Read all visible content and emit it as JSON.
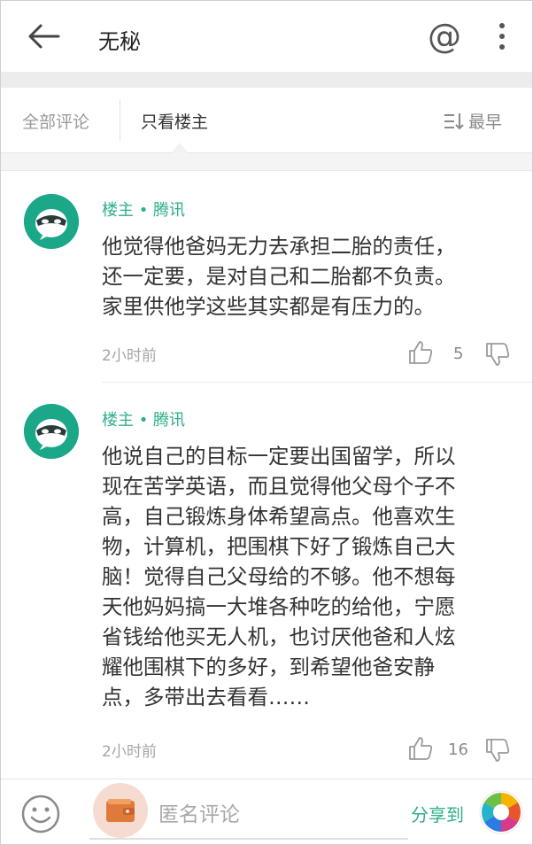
{
  "header": {
    "title": "无秘",
    "at_symbol": "@"
  },
  "filter": {
    "all_label": "全部评论",
    "owner_label": "只看楼主",
    "sort_label": "最早"
  },
  "comments": [
    {
      "author": "楼主 • 腾讯",
      "text": "他觉得他爸妈无力去承担二胎的责任，\n还一定要，是对自己和二胎都不负责。\n家里供他学这些其实都是有压力的。",
      "time": "2小时前",
      "likes": "5"
    },
    {
      "author": "楼主 • 腾讯",
      "text": "他说自己的目标一定要出国留学，所以\n现在苦学英语，而且觉得他父母个子不\n高，自己锻炼身体希望高点。他喜欢生\n物，计算机，把围棋下好了锻炼自己大\n脑！觉得自己父母给的不够。他不想每\n天他妈妈搞一大堆各种吃的给他，宁愿\n省钱给他买无人机，也讨厌他爸和人炫\n耀他围棋下的多好，到希望他爸安静\n点，多带出去看看……",
      "time": "2小时前",
      "likes": "16"
    }
  ],
  "footer": {
    "input_placeholder": "匿名评论",
    "share_label": "分享到"
  },
  "colors": {
    "accent": "#2fae8a",
    "avatar": "#1aa889"
  },
  "icons": {
    "back": "back-arrow-icon",
    "more": "more-vertical-icon",
    "sort": "sort-icon",
    "like": "thumbs-up-icon",
    "dislike": "thumbs-down-icon",
    "emoji": "emoji-icon",
    "share": "share-app-icon"
  }
}
